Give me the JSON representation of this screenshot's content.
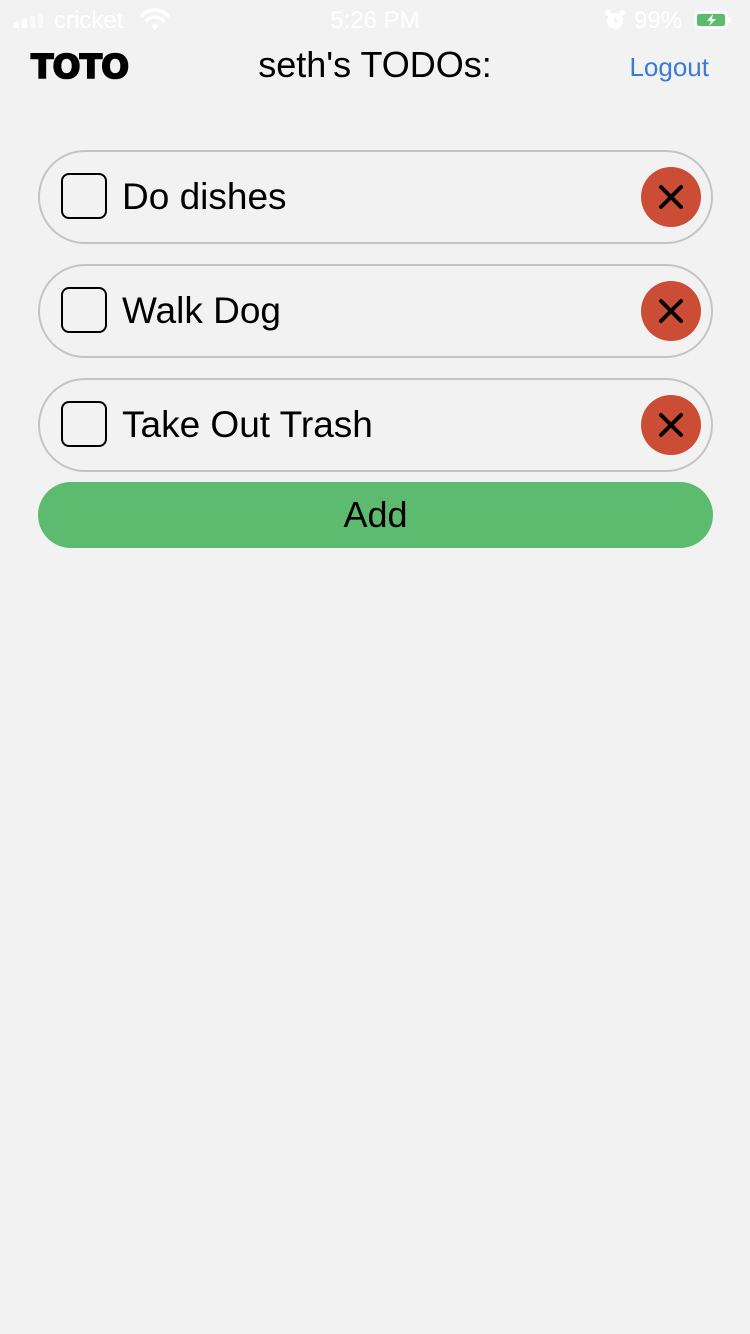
{
  "status_bar": {
    "carrier": "cricket",
    "time": "5:26 PM",
    "battery_percent": "99%",
    "signal_icon": "signal-bars-icon",
    "wifi_icon": "wifi-icon",
    "alarm_icon": "alarm-clock-icon",
    "battery_icon": "battery-charging-icon",
    "battery_color": "#5cbb6e"
  },
  "header": {
    "logo": "TOTO",
    "title": "seth's TODOs:",
    "logout_label": "Logout",
    "logout_color": "#3a7bd5"
  },
  "todos": [
    {
      "text": "Do dishes",
      "checked": false
    },
    {
      "text": "Walk Dog",
      "checked": false
    },
    {
      "text": "Take Out Trash",
      "checked": false
    }
  ],
  "add_button": {
    "label": "Add",
    "color": "#5cbb6e"
  },
  "colors": {
    "background": "#f2f2f2",
    "delete": "#cc4d35",
    "item_border": "#c4c4c4"
  },
  "icons": {
    "delete": "close-icon"
  }
}
